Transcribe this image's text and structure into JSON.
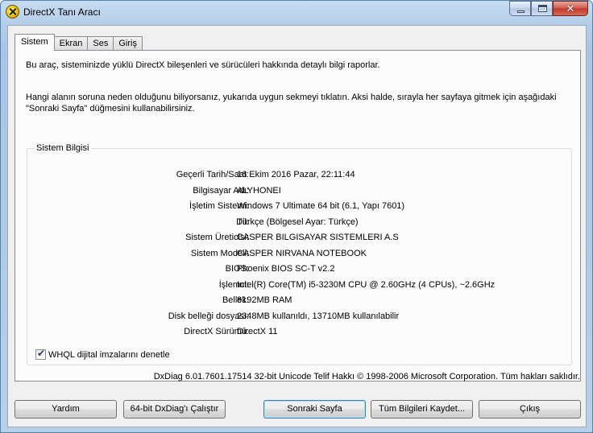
{
  "window": {
    "title": "DirectX Tanı Aracı",
    "close_glyph": "✕"
  },
  "tabs": [
    {
      "label": "Sistem",
      "active": true
    },
    {
      "label": "Ekran",
      "active": false
    },
    {
      "label": "Ses",
      "active": false
    },
    {
      "label": "Giriş",
      "active": false
    }
  ],
  "intro_text": "Bu araç, sisteminizde yüklü DirectX bileşenleri ve sürücüleri hakkında detaylı bilgi raporlar.",
  "hint_text": "Hangi alanın soruna neden olduğunu biliyorsanız, yukarıda uygun sekmeyi tıklatın.  Aksi halde, sırayla her sayfaya gitmek için aşağıdaki \"Sonraki Sayfa\" düğmesini kullanabilirsiniz.",
  "system_info": {
    "title": "Sistem Bilgisi",
    "rows": [
      {
        "label": "Geçerli Tarih/Saat:",
        "value": "16 Ekim 2016 Pazar, 22:11:44"
      },
      {
        "label": "Bilgisayar Adı:",
        "value": "ALYHONEI"
      },
      {
        "label": "İşletim Sistemi:",
        "value": "Windows 7 Ultimate 64 bit (6.1, Yapı 7601)"
      },
      {
        "label": "Dil:",
        "value": "Türkçe (Bölgesel Ayar: Türkçe)"
      },
      {
        "label": "Sistem Üreticisi:",
        "value": "CASPER BILGISAYAR SISTEMLERI A.S"
      },
      {
        "label": "Sistem Modeli:",
        "value": "CASPER NIRVANA NOTEBOOK"
      },
      {
        "label": "BIOS:",
        "value": "Phoenix BIOS SC-T v2.2"
      },
      {
        "label": "İşlemci:",
        "value": "Intel(R) Core(TM) i5-3230M CPU @ 2.60GHz (4 CPUs), ~2.6GHz"
      },
      {
        "label": "Bellek:",
        "value": "8192MB RAM"
      },
      {
        "label": "Disk belleği dosyası:",
        "value": "2348MB kullanıldı, 13710MB kullanılabilir"
      },
      {
        "label": "DirectX Sürümü:",
        "value": "DirectX 11"
      }
    ]
  },
  "whql": {
    "label": "WHQL dijital imzalarını denetle",
    "checked": true,
    "check_glyph": "✔"
  },
  "footer": "DxDiag 6.01.7601.17514 32-bit Unicode  Telif Hakkı © 1998-2006 Microsoft Corporation.  Tüm hakları saklıdır.",
  "buttons": {
    "help": "Yardım",
    "run64": "64-bit DxDiag'ı Çalıştır",
    "next": "Sonraki Sayfa",
    "save": "Tüm Bilgileri Kaydet...",
    "exit": "Çıkış"
  }
}
